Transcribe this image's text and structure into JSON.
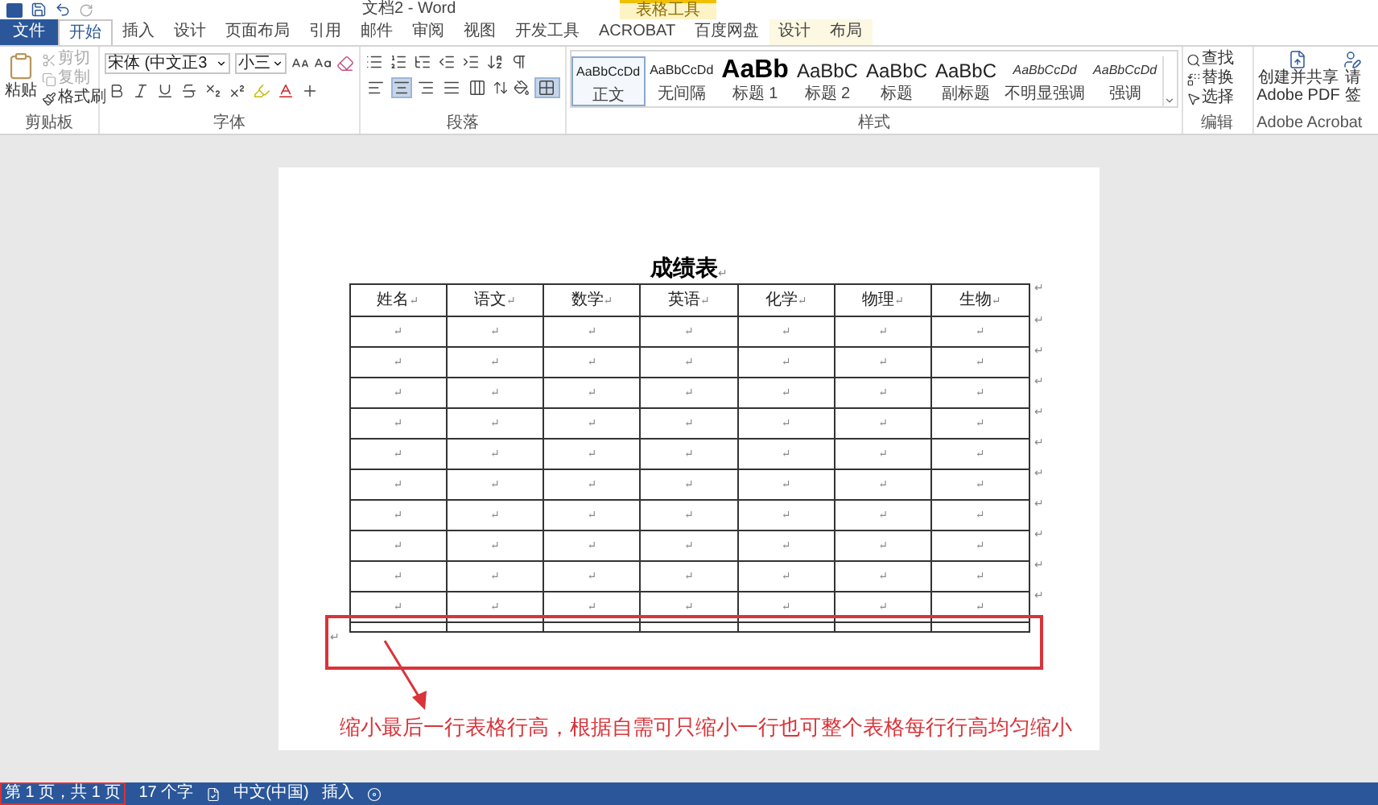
{
  "window": {
    "title": "文档2 - Word"
  },
  "context_tab_group": {
    "label": "表格工具"
  },
  "file_tab": {
    "label": "文件"
  },
  "tabs": [
    {
      "label": "开始",
      "selected": true
    },
    {
      "label": "插入",
      "selected": false
    },
    {
      "label": "设计",
      "selected": false
    },
    {
      "label": "页面布局",
      "selected": false
    },
    {
      "label": "引用",
      "selected": false
    },
    {
      "label": "邮件",
      "selected": false
    },
    {
      "label": "审阅",
      "selected": false
    },
    {
      "label": "视图",
      "selected": false
    },
    {
      "label": "开发工具",
      "selected": false
    },
    {
      "label": "ACROBAT",
      "selected": false
    },
    {
      "label": "百度网盘",
      "selected": false
    },
    {
      "label": "设计",
      "selected": false,
      "context": true
    },
    {
      "label": "布局",
      "selected": false,
      "context": true
    }
  ],
  "clipboard": {
    "label": "剪贴板",
    "paste": "粘贴",
    "items": [
      {
        "label": "剪切",
        "disabled": true
      },
      {
        "label": "复制",
        "disabled": true
      },
      {
        "label": "格式刷",
        "disabled": false
      }
    ]
  },
  "font": {
    "label": "字体",
    "font_name": "宋体 (中文正3",
    "font_size": "小三"
  },
  "paragraph": {
    "label": "段落",
    "alignments": [
      {
        "selected": false
      },
      {
        "selected": true
      },
      {
        "selected": false
      },
      {
        "selected": false
      },
      {
        "selected": false
      }
    ],
    "borders_selected": true
  },
  "styles": {
    "label": "样式",
    "items": [
      {
        "preview": "AaBbCcDd",
        "name": "正文",
        "kind": "normal",
        "selected": true
      },
      {
        "preview": "AaBbCcDd",
        "name": "无间隔",
        "kind": "normal",
        "selected": false
      },
      {
        "preview": "AaBb",
        "name": "标题 1",
        "kind": "heading1",
        "selected": false
      },
      {
        "preview": "AaBbC",
        "name": "标题 2",
        "kind": "heading2",
        "selected": false
      },
      {
        "preview": "AaBbC",
        "name": "标题",
        "kind": "heading2",
        "selected": false
      },
      {
        "preview": "AaBbC",
        "name": "副标题",
        "kind": "heading2",
        "selected": false
      },
      {
        "preview": "AaBbCcDd",
        "name": "不明显强调",
        "kind": "italic",
        "selected": false
      },
      {
        "preview": "AaBbCcDd",
        "name": "强调",
        "kind": "italic",
        "selected": false
      }
    ]
  },
  "editing": {
    "label": "编辑",
    "items": [
      "查找",
      "替换",
      "选择"
    ]
  },
  "acrobat": {
    "label": "Adobe Acrobat",
    "create": [
      "创建并共享",
      "Adobe PDF"
    ],
    "request": [
      "请",
      "签"
    ]
  },
  "document": {
    "title": "成绩表",
    "title_mark": "↵",
    "columns": [
      {
        "text": "姓名",
        "mark": "↵"
      },
      {
        "text": "语文",
        "mark": "↵"
      },
      {
        "text": "数学",
        "mark": "↵"
      },
      {
        "text": "英语",
        "mark": "↵"
      },
      {
        "text": "化学",
        "mark": "↵"
      },
      {
        "text": "物理",
        "mark": "↵"
      },
      {
        "text": "生物",
        "mark": "↵"
      }
    ],
    "header_end_mark": "↵",
    "rows": [
      {
        "cells": [
          "↵",
          "↵",
          "↵",
          "↵",
          "↵",
          "↵",
          "↵"
        ],
        "end": "↵"
      },
      {
        "cells": [
          "↵",
          "↵",
          "↵",
          "↵",
          "↵",
          "↵",
          "↵"
        ],
        "end": "↵"
      },
      {
        "cells": [
          "↵",
          "↵",
          "↵",
          "↵",
          "↵",
          "↵",
          "↵"
        ],
        "end": "↵"
      },
      {
        "cells": [
          "↵",
          "↵",
          "↵",
          "↵",
          "↵",
          "↵",
          "↵"
        ],
        "end": "↵"
      },
      {
        "cells": [
          "↵",
          "↵",
          "↵",
          "↵",
          "↵",
          "↵",
          "↵"
        ],
        "end": "↵"
      },
      {
        "cells": [
          "↵",
          "↵",
          "↵",
          "↵",
          "↵",
          "↵",
          "↵"
        ],
        "end": "↵"
      },
      {
        "cells": [
          "↵",
          "↵",
          "↵",
          "↵",
          "↵",
          "↵",
          "↵"
        ],
        "end": "↵"
      },
      {
        "cells": [
          "↵",
          "↵",
          "↵",
          "↵",
          "↵",
          "↵",
          "↵"
        ],
        "end": "↵"
      },
      {
        "cells": [
          "↵",
          "↵",
          "↵",
          "↵",
          "↵",
          "↵",
          "↵"
        ],
        "end": "↵"
      },
      {
        "cells": [
          "↵",
          "↵",
          "↵",
          "↵",
          "↵",
          "↵",
          "↵"
        ],
        "end": "↵"
      }
    ],
    "after_mark": "↵",
    "annotation": "缩小最后一行表格行高，根据自需可只缩小一行也可整个表格每行行高均匀缩小"
  },
  "status_bar": {
    "page": "第 1 页，共 1 页",
    "words": "17 个字",
    "language": "中文(中国)",
    "mode": "插入"
  }
}
